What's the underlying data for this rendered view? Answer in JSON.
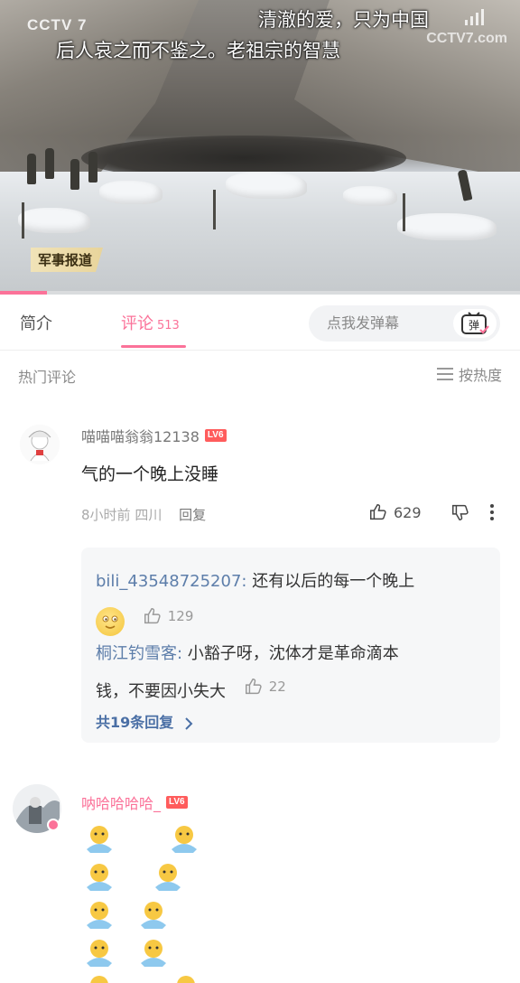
{
  "video": {
    "logo_left": "CCTV 7",
    "logo_right": "CCTV7.com",
    "danmaku": [
      "清澈的爱，只为中国",
      "后人哀之而不鉴之。老祖宗的智慧"
    ],
    "program_badge": "军事报道",
    "progress": 0.09
  },
  "tabs": {
    "intro": "简介",
    "comments": "评论",
    "comment_count": "513",
    "danmaku_placeholder": "点我发弹幕",
    "danmaku_icon_label": "弹"
  },
  "sort": {
    "title": "热门评论",
    "label": "按热度"
  },
  "comment1": {
    "username": "喵喵喵翁翁12138",
    "level": "LV6",
    "text": "气的一个晚上没睡",
    "time": "8小时前",
    "location": "四川",
    "reply": "回复",
    "likes": "629"
  },
  "replies": {
    "r1_name": "bili_43548725207:",
    "r1_text": " 还有以后的每一个晚上",
    "r1_likes": "129",
    "r2_name": "桐江钓雪客:",
    "r2_text": " 小豁子呀，沈体才是革命滴本",
    "r2_text2": "钱，不要因小失大",
    "r2_likes": "22",
    "more": "共19条回复"
  },
  "comment2": {
    "username": "呐哈哈哈哈_",
    "level": "LV6"
  },
  "colors": {
    "accent": "#fb7299",
    "reply_name": "#5d7eaa",
    "level_badge": "#ff5c5c"
  }
}
